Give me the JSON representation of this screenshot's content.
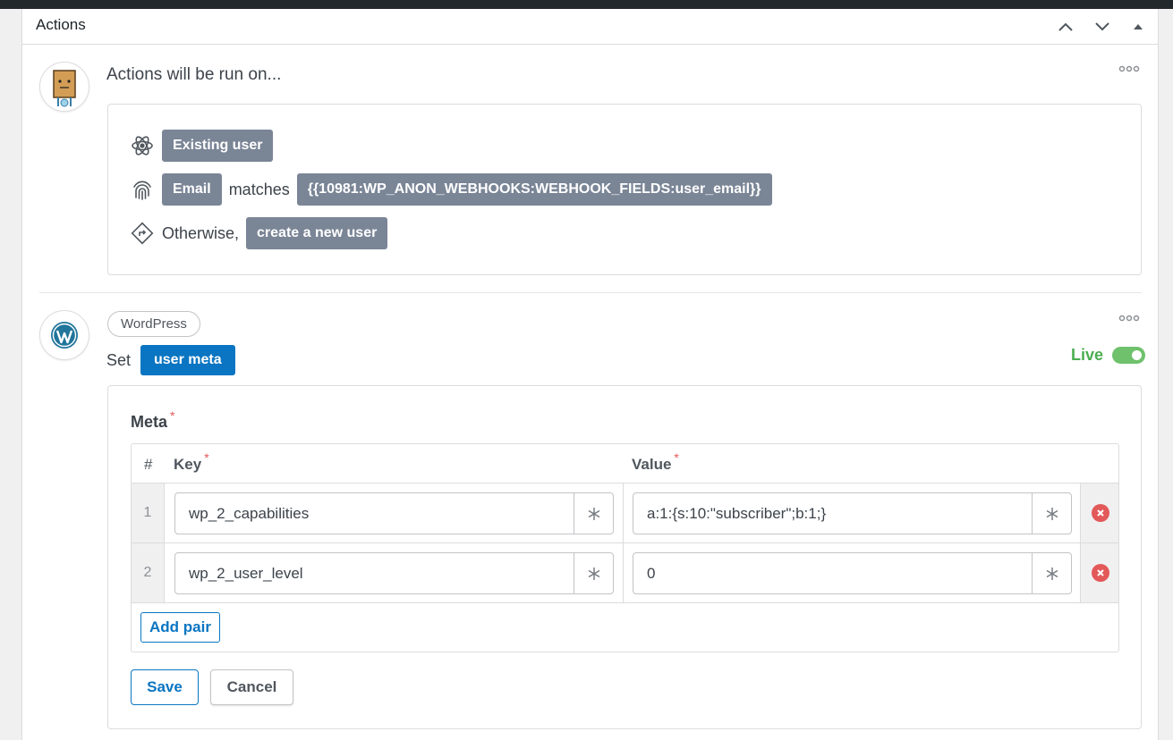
{
  "panel": {
    "title": "Actions"
  },
  "run_on": {
    "heading": "Actions will be run on...",
    "existing_user": "Existing user",
    "field": "Email",
    "matches": "matches",
    "token": "{{10981:WP_ANON_WEBHOOKS:WEBHOOK_FIELDS:user_email}}",
    "otherwise": "Otherwise,",
    "fallback": "create a new user"
  },
  "action": {
    "integration": "WordPress",
    "set": "Set",
    "meta_label": "user meta",
    "status": "Live",
    "status_on": true
  },
  "form": {
    "meta_label": "Meta",
    "required": "*",
    "columns": {
      "num": "#",
      "key": "Key",
      "value": "Value"
    },
    "rows": [
      {
        "num": "1",
        "key": "wp_2_capabilities",
        "value": "a:1:{s:10:\"subscriber\";b:1;}"
      },
      {
        "num": "2",
        "key": "wp_2_user_level",
        "value": "0"
      }
    ],
    "add_pair": "Add pair",
    "save": "Save",
    "cancel": "Cancel"
  },
  "colors": {
    "accent": "#0a75c2",
    "live": "#4bae4f",
    "pill": "#7a8596",
    "danger": "#e35959"
  }
}
